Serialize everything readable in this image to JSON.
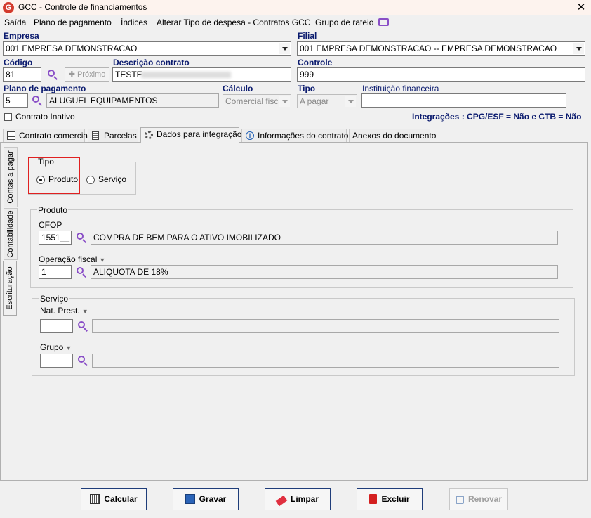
{
  "window": {
    "title": "GCC - Controle de financiamentos",
    "icon": "app-logo-icon",
    "close_label": "✕"
  },
  "menu": [
    {
      "label": "Saída"
    },
    {
      "label": "Plano de pagamento"
    },
    {
      "label": "Índices"
    },
    {
      "label": "Alterar Tipo de despesa - Contratos GCC"
    },
    {
      "label": "Grupo de rateio"
    }
  ],
  "header": {
    "empresa": {
      "label": "Empresa",
      "value": "001 EMPRESA DEMONSTRACAO"
    },
    "filial": {
      "label": "Filial",
      "value": "001 EMPRESA DEMONSTRACAO -- EMPRESA DEMONSTRACAO"
    },
    "codigo": {
      "label": "Código",
      "value": "81"
    },
    "proximo_label": "Próximo",
    "descricao": {
      "label": "Descrição contrato",
      "value": "TESTE"
    },
    "controle": {
      "label": "Controle",
      "value": "999"
    },
    "plano": {
      "label": "Plano de pagamento",
      "code": "5",
      "value": "ALUGUEL EQUIPAMENTOS"
    },
    "calculo": {
      "label": "Cálculo",
      "value": "Comercial fiscal"
    },
    "tipo": {
      "label": "Tipo",
      "value": "A pagar"
    },
    "instituicao": {
      "label": "Instituição financeira",
      "value": ""
    },
    "contrato_inativo": "Contrato Inativo",
    "integracoes": "Integrações : CPG/ESF = Não e CTB = Não"
  },
  "tabs": [
    {
      "label": "Contrato comercial",
      "icon": "table-icon"
    },
    {
      "label": "Parcelas",
      "icon": "document-icon"
    },
    {
      "label": "Dados para integração",
      "icon": "gear-icon",
      "active": true
    },
    {
      "label": "Informações do contrato",
      "icon": "info-icon"
    },
    {
      "label": "Anexos do documento",
      "icon": ""
    }
  ],
  "side_tabs": [
    {
      "label": "Contas a pagar"
    },
    {
      "label": "Contabilidade"
    },
    {
      "label": "Escrituração",
      "active": true
    }
  ],
  "tipo_group": {
    "legend": "Tipo",
    "options": [
      {
        "label": "Produto",
        "selected": true
      },
      {
        "label": "Serviço",
        "selected": false
      }
    ]
  },
  "produto_group": {
    "legend": "Produto",
    "cfop": {
      "label": "CFOP",
      "code": "1551__",
      "value": "COMPRA DE BEM PARA O ATIVO IMOBILIZADO"
    },
    "operacao": {
      "label": "Operação fiscal",
      "code": "1",
      "value": "ALIQUOTA DE 18%"
    }
  },
  "servico_group": {
    "legend": "Serviço",
    "nat_prest": {
      "label": "Nat. Prest.",
      "code": "",
      "value": ""
    },
    "grupo": {
      "label": "Grupo",
      "code": "",
      "value": ""
    }
  },
  "buttons": [
    {
      "label": "Calcular",
      "icon": "calculator-icon"
    },
    {
      "label": "Gravar",
      "icon": "save-icon"
    },
    {
      "label": "Limpar",
      "icon": "eraser-icon"
    },
    {
      "label": "Excluir",
      "icon": "trash-icon"
    },
    {
      "label": "Renovar",
      "icon": "copy-icon",
      "disabled": true
    }
  ],
  "colors": {
    "label_blue": "#0a1a6e",
    "accent_purple": "#8a4fc7",
    "highlight_red": "#e02020",
    "button_border": "#1f3d7a"
  }
}
